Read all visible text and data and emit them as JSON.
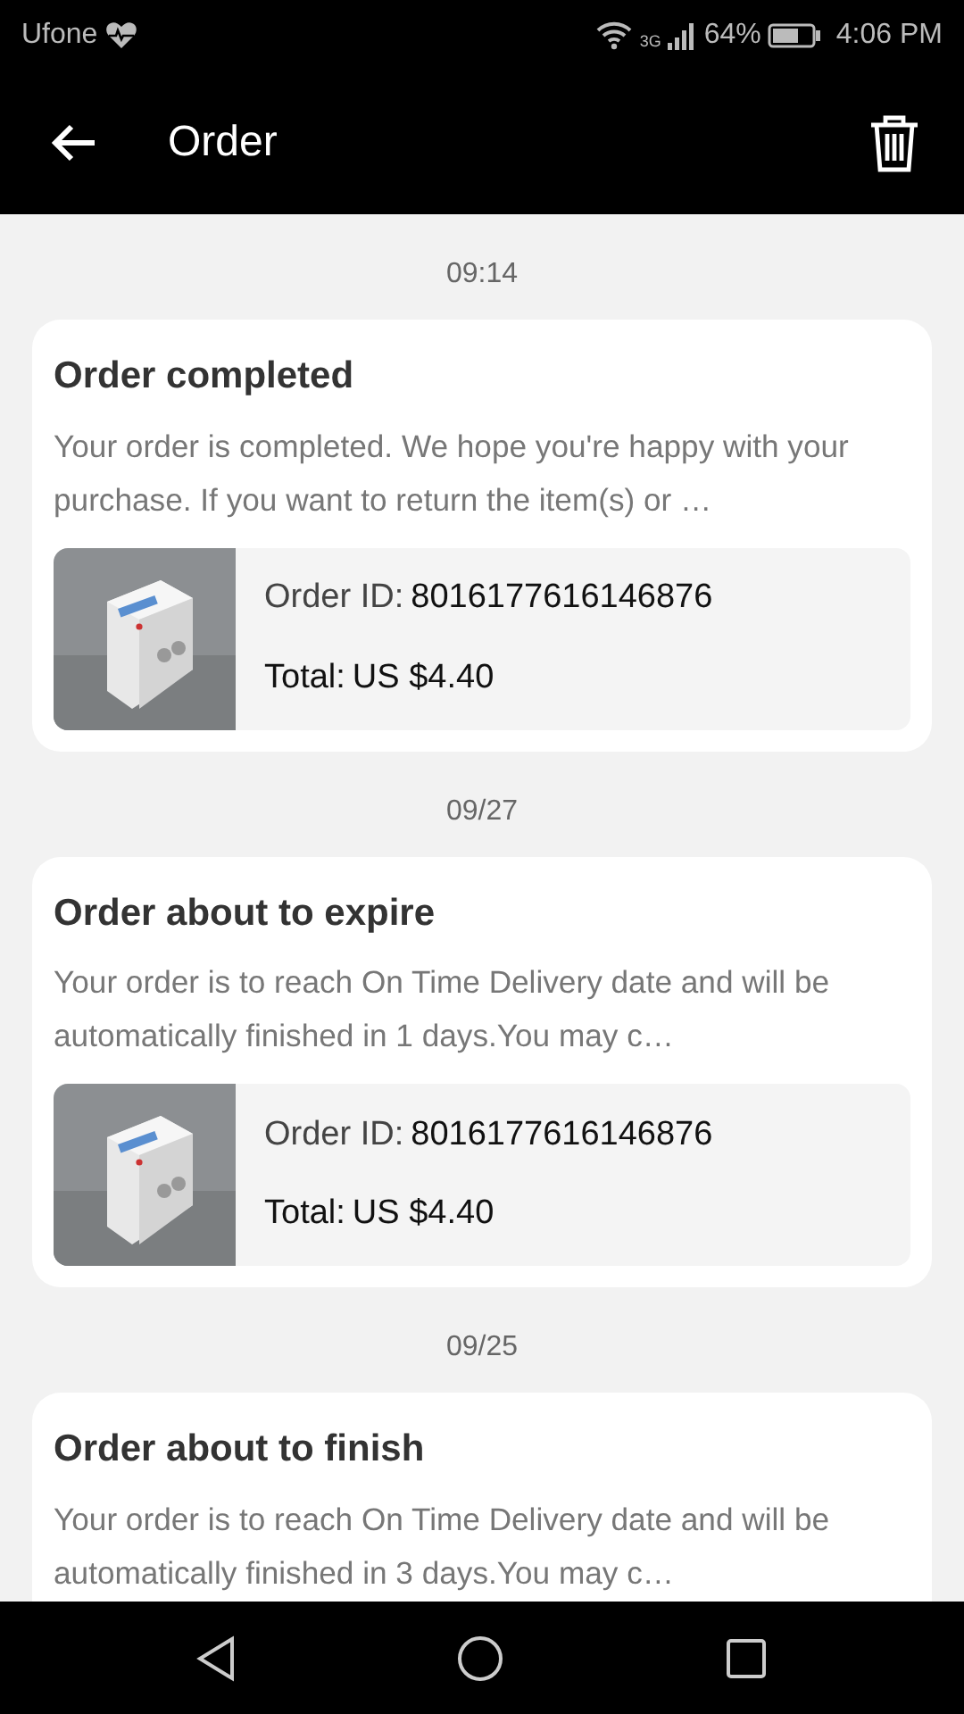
{
  "status_bar": {
    "carrier": "Ufone",
    "network": "3G",
    "battery": "64%",
    "time": "4:06 PM"
  },
  "header": {
    "title": "Order"
  },
  "messages": [
    {
      "time": "09:14",
      "title": "Order completed",
      "text": "Your order is completed. We hope you're happy with your purchase. If you want to return the item(s) or …",
      "product": {
        "order_id_label": "Order ID:",
        "order_id": "8016177616146876",
        "total_label": "Total:",
        "total": "US $4.40"
      }
    },
    {
      "time": "09/27",
      "title": "Order about to expire",
      "text": "Your order is to reach On Time Delivery date and will be automatically finished in 1 days.You may c…",
      "product": {
        "order_id_label": "Order ID:",
        "order_id": "8016177616146876",
        "total_label": "Total:",
        "total": "US $4.40"
      }
    },
    {
      "time": "09/25",
      "title": "Order about to finish",
      "text": "Your order is to reach On Time Delivery date and will be automatically finished in 3 days.You may c…"
    }
  ]
}
